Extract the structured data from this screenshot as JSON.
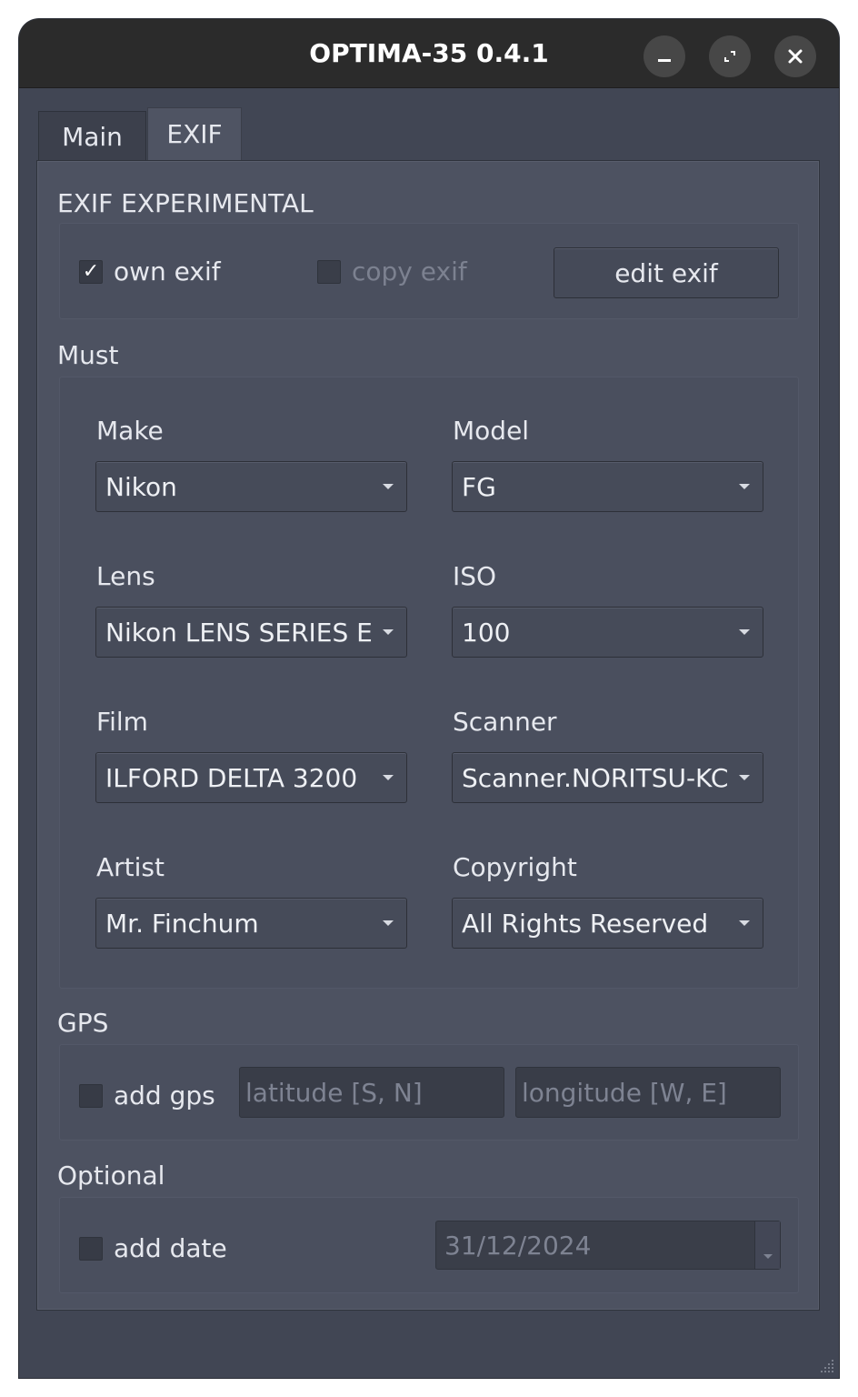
{
  "window": {
    "title": "OPTIMA-35 0.4.1",
    "controls": [
      "minimize-icon",
      "maximize-icon",
      "close-icon"
    ]
  },
  "tabs": [
    {
      "label": "Main",
      "selected": false
    },
    {
      "label": "EXIF",
      "selected": true
    }
  ],
  "exif_experimental": {
    "heading": "EXIF EXPERIMENTAL",
    "own_exif": {
      "label": "own exif",
      "checked": true
    },
    "copy_exif": {
      "label": "copy exif",
      "checked": false,
      "enabled": false
    },
    "edit_button": "edit exif"
  },
  "must": {
    "heading": "Must",
    "make": {
      "label": "Make",
      "value": "Nikon"
    },
    "model": {
      "label": "Model",
      "value": "FG"
    },
    "lens": {
      "label": "Lens",
      "value": "Nikon LENS SERIES E"
    },
    "iso": {
      "label": "ISO",
      "value": "100"
    },
    "film": {
      "label": "Film",
      "value": "ILFORD DELTA 3200"
    },
    "scanner": {
      "label": "Scanner",
      "value": "Scanner.NORITSU-KC"
    },
    "artist": {
      "label": "Artist",
      "value": "Mr. Finchum"
    },
    "copyright": {
      "label": "Copyright",
      "value": "All Rights Reserved"
    }
  },
  "gps": {
    "heading": "GPS",
    "add_gps": {
      "label": "add gps",
      "checked": false
    },
    "latitude_placeholder": "latitude [S, N]",
    "longitude_placeholder": "longitude [W, E]"
  },
  "optional": {
    "heading": "Optional",
    "add_date": {
      "label": "add date",
      "checked": false
    },
    "date_value": "31/12/2024"
  },
  "colors": {
    "window_bg": "#414654",
    "titlebar_bg": "#2b2b2b",
    "panel_bg": "#4d5261",
    "text": "#e6e8ee",
    "disabled_text": "#7c8190"
  }
}
